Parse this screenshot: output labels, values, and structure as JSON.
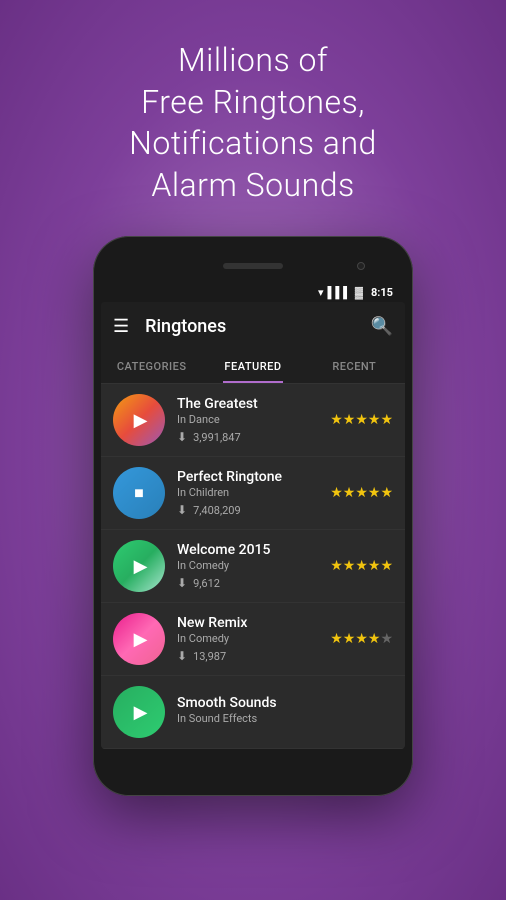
{
  "hero": {
    "line1": "Millions of",
    "line2": "Free Ringtones,",
    "line3": "Notifications and",
    "line4": "Alarm Sounds"
  },
  "status": {
    "time": "8:15"
  },
  "appbar": {
    "title": "Ringtones",
    "menu_label": "☰",
    "search_label": "🔍"
  },
  "tabs": [
    {
      "id": "categories",
      "label": "CATEGORIES",
      "active": false
    },
    {
      "id": "featured",
      "label": "FEATURED",
      "active": true
    },
    {
      "id": "recent",
      "label": "RECENT",
      "active": false
    }
  ],
  "songs": [
    {
      "name": "The Greatest",
      "category": "In Dance",
      "downloads": "3,991,847",
      "stars": 5,
      "thumb_class": "thumb-1",
      "icon": "play"
    },
    {
      "name": "Perfect Ringtone",
      "category": "In Children",
      "downloads": "7,408,209",
      "stars": 5,
      "thumb_class": "thumb-2",
      "icon": "stop"
    },
    {
      "name": "Welcome 2015",
      "category": "In Comedy",
      "downloads": "9,612",
      "stars": 5,
      "thumb_class": "thumb-3",
      "icon": "play"
    },
    {
      "name": "New Remix",
      "category": "In Comedy",
      "downloads": "13,987",
      "stars": 4,
      "thumb_class": "thumb-4",
      "icon": "play"
    },
    {
      "name": "Smooth Sounds",
      "category": "In Sound Effects",
      "downloads": "",
      "stars": 0,
      "thumb_class": "thumb-5",
      "icon": "play"
    }
  ],
  "icons": {
    "play": "▶",
    "stop": "■",
    "hamburger": "☰",
    "search": "🔍",
    "download": "⬇",
    "wifi": "▲",
    "signal": "▌▌▌",
    "battery": "▓"
  }
}
